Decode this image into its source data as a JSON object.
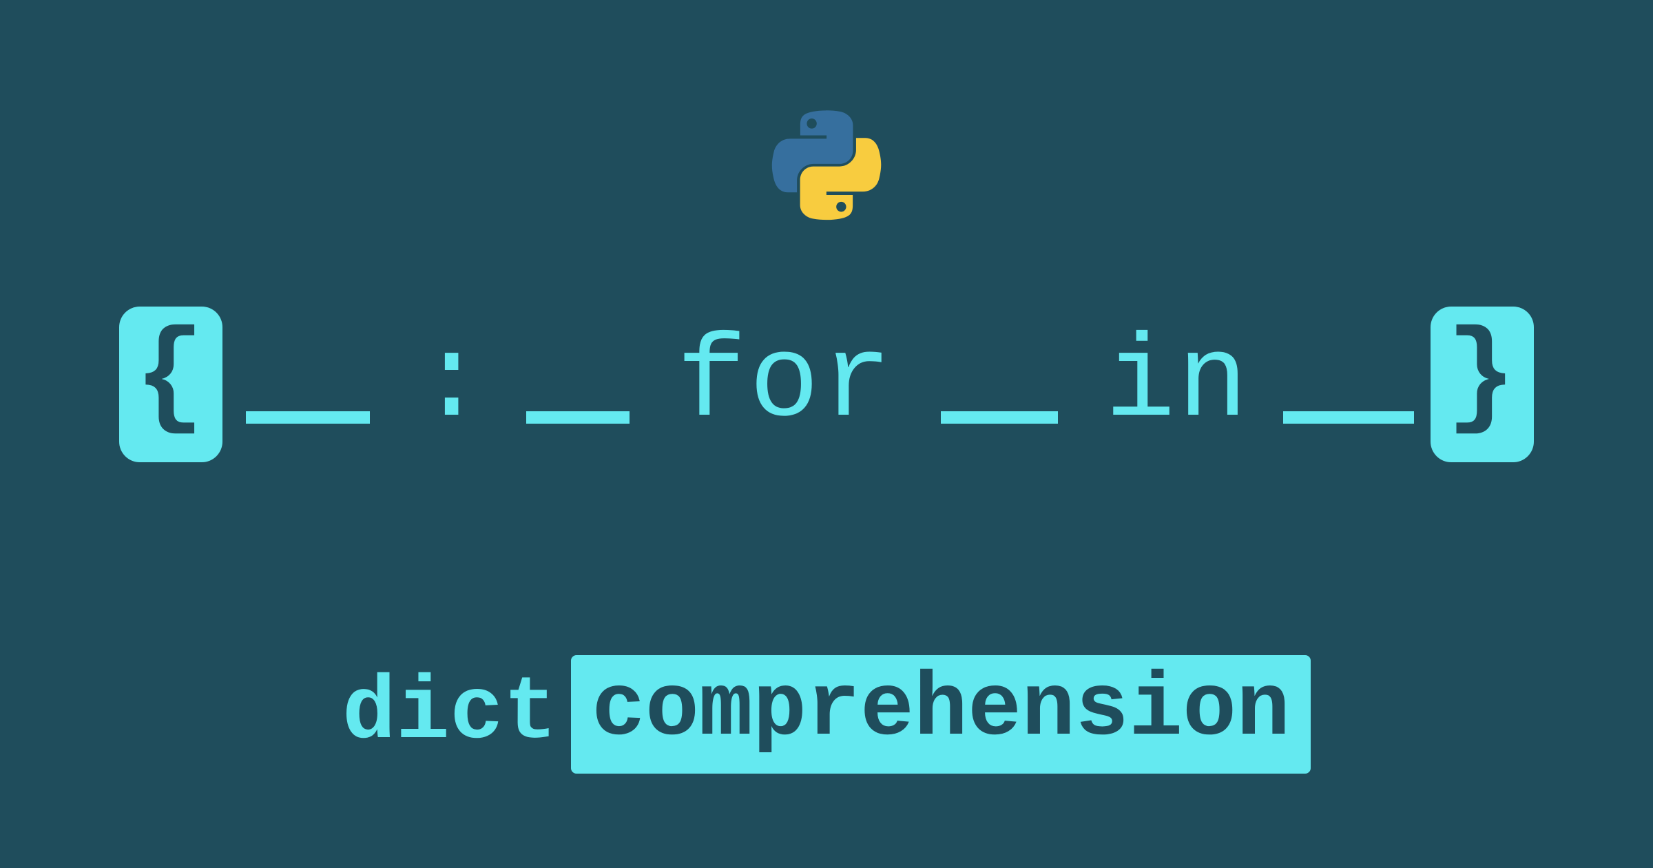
{
  "logo": {
    "name": "python-logo"
  },
  "syntax": {
    "open_brace": "{",
    "colon": ":",
    "for": "for",
    "in": "in",
    "close_brace": "}"
  },
  "label": {
    "prefix": "dict",
    "highlight": "comprehension"
  },
  "colors": {
    "bg": "#1f4d5c",
    "accent": "#64e9f0",
    "python_blue": "#366f9e",
    "python_yellow": "#f8cc3f"
  }
}
